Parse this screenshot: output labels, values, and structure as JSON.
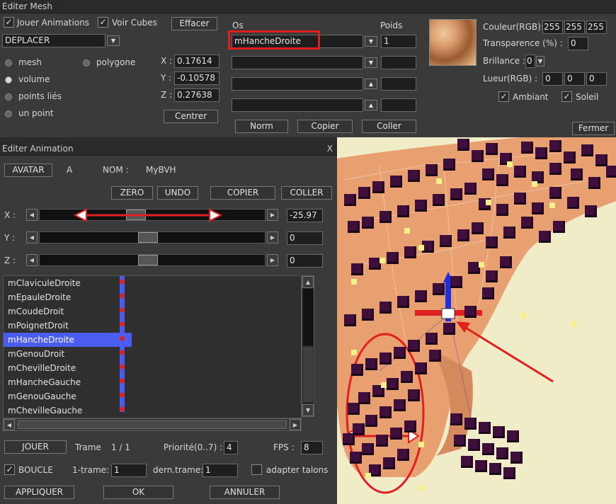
{
  "mesh_editor": {
    "title": "Editer Mesh",
    "jouer_animations": "Jouer Animations",
    "voir_cubes": "Voir Cubes",
    "effacer": "Effacer",
    "mode_value": "DEPLACER",
    "radio_mesh": "mesh",
    "radio_polygone": "polygone",
    "radio_volume": "volume",
    "radio_points_lies": "points liés",
    "radio_un_point": "un point",
    "x_label": "X :",
    "y_label": "Y :",
    "z_label": "Z :",
    "x_value": "0.17614",
    "y_value": "-0.10578",
    "z_value": "0.27638",
    "centrer": "Centrer",
    "os_label": "Os",
    "poids_label": "Poids",
    "os_value": "mHancheDroite",
    "poids_value": "1",
    "norm": "Norm",
    "copier": "Copier",
    "coller": "Coller",
    "couleur_label": "Couleur(RGB):",
    "couleur_values": [
      "255",
      "255",
      "255"
    ],
    "transparence_label": "Transparence (%) :",
    "transparence_value": "0",
    "brillance_label": "Brillance :",
    "brillance_value": "0",
    "lueur_label": "Lueur(RGB) :",
    "lueur_values": [
      "0",
      "0",
      "0"
    ],
    "ambiant": "Ambiant",
    "soleil": "Soleil",
    "fermer": "Fermer"
  },
  "anim_editor": {
    "title": "Editer Animation",
    "close_glyph": "X",
    "avatar_btn": "AVATAR",
    "avatar_value": "A",
    "nom_label": "NOM :",
    "nom_value": "MyBVH",
    "zero": "ZERO",
    "undo": "UNDO",
    "copier": "COPIER",
    "coller": "COLLER",
    "x_label": "X :",
    "y_label": "Y :",
    "z_label": "Z :",
    "x_value": "-25.97",
    "y_value": "0",
    "z_value": "0",
    "slider_x": 0.42,
    "slider_y": 0.48,
    "slider_z": 0.48,
    "bones": [
      "mClaviculeDroite",
      "mEpauleDroite",
      "mCoudeDroit",
      "mPoignetDroit",
      "mHancheDroite",
      "mGenouDroit",
      "mChevilleDroite",
      "mHancheGauche",
      "mGenouGauche",
      "mChevilleGauche"
    ],
    "selected_bone_index": 4,
    "jouer": "JOUER",
    "trame_label": "Trame",
    "trame_value": "1 / 1",
    "priorite_label": "Priorité(0..7) :",
    "priorite_value": "4",
    "fps_label": "FPS :",
    "fps_value": "8",
    "boucle": "BOUCLE",
    "un_trame_label": "1-trame:",
    "un_trame_value": "1",
    "dern_trame_label": "dern.trame:",
    "dern_trame_value": "1",
    "adapter_talons": "adapter talons",
    "appliquer": "APPLIQUER",
    "ok": "OK",
    "annuler": "ANNULER"
  },
  "icons": {
    "check": "✓",
    "dropdown": "▼",
    "up": "▲",
    "left": "◀",
    "right": "▶"
  },
  "colors": {
    "annotation_red": "#e02020",
    "selection_blue": "#4b5cf0",
    "skin": "#e8a070"
  }
}
